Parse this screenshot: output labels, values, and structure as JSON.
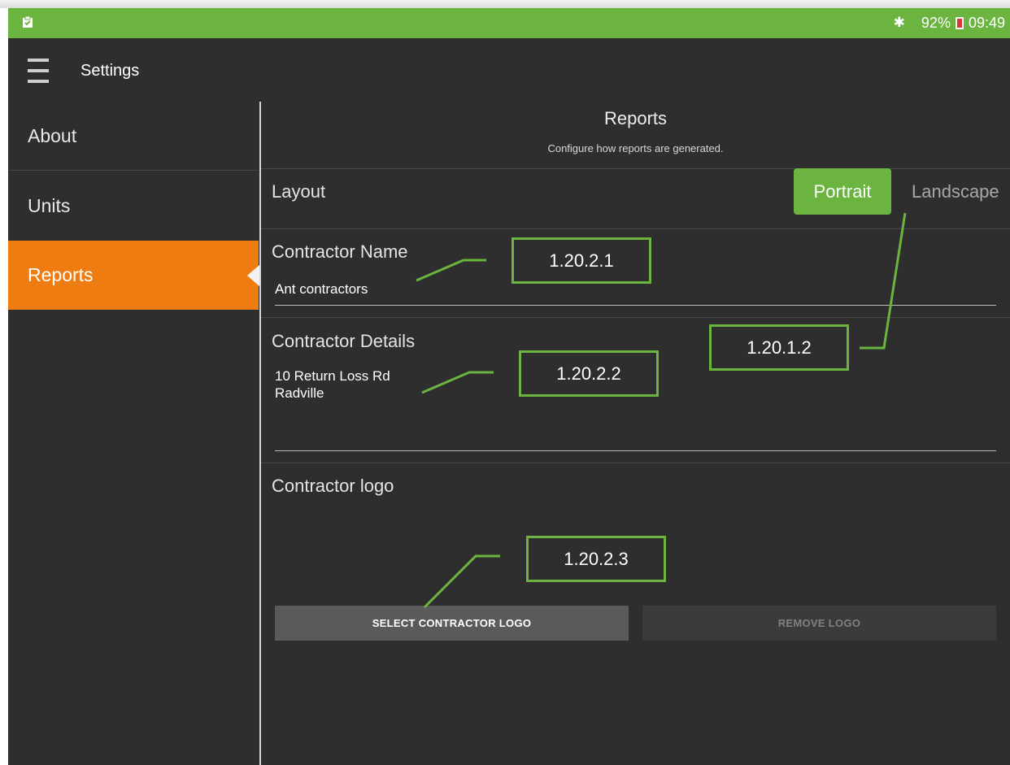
{
  "status_bar": {
    "battery": "92%",
    "time": "09:49",
    "icons": [
      "clipboard-icon",
      "bluetooth-icon",
      "battery-icon"
    ]
  },
  "app_bar": {
    "title": "Settings",
    "menu_icon": "hamburger-menu-icon"
  },
  "sidebar": {
    "items": [
      {
        "label": "About"
      },
      {
        "label": "Units"
      },
      {
        "label": "Reports",
        "active": true
      }
    ]
  },
  "main": {
    "title": "Reports",
    "subtitle": "Configure how reports are generated.",
    "layout": {
      "label": "Layout",
      "options": [
        "Portrait",
        "Landscape"
      ],
      "selected": "Portrait"
    },
    "contractor_name": {
      "label": "Contractor Name",
      "value": "Ant contractors"
    },
    "contractor_details": {
      "label": "Contractor Details",
      "line1": "10 Return Loss Rd",
      "line2": "Radville"
    },
    "contractor_logo": {
      "label": "Contractor logo",
      "select_button": "SELECT CONTRACTOR LOGO",
      "remove_button": "REMOVE LOGO"
    }
  },
  "annotations": {
    "a1": "1.20.2.1",
    "a2": "1.20.2.2",
    "a3": "1.20.1.2",
    "a4": "1.20.2.3"
  },
  "colors": {
    "accent_green": "#6bb440",
    "active_orange": "#ef7c10",
    "background": "#2e2e2e"
  }
}
